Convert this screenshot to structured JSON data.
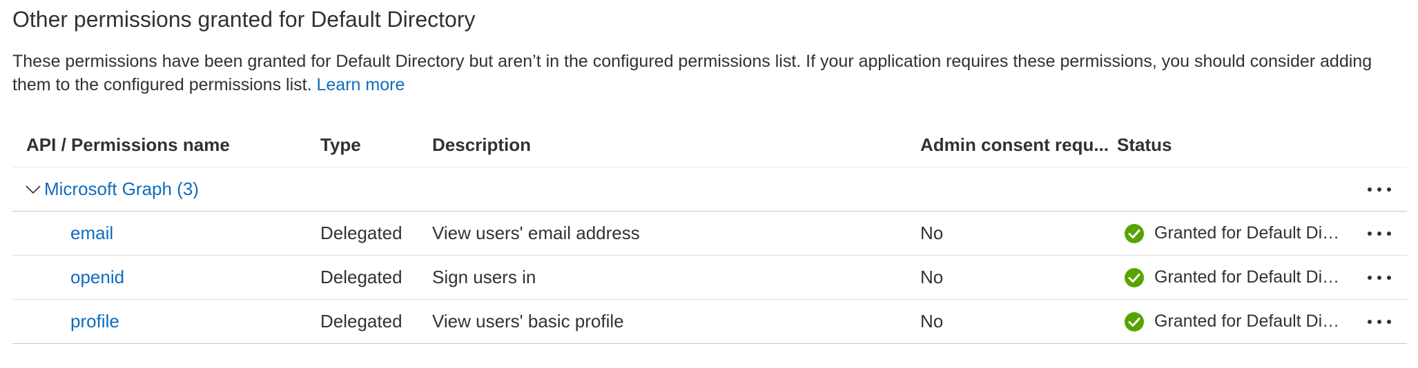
{
  "section": {
    "title": "Other permissions granted for Default Directory",
    "description": "These permissions have been granted for Default Directory but aren’t in the configured permissions list. If your application requires these permissions, you should consider adding them to the configured permissions list.",
    "learn_more_label": "Learn more"
  },
  "table": {
    "columns": {
      "name": "API / Permissions name",
      "type": "Type",
      "description": "Description",
      "admin": "Admin consent requ...",
      "status": "Status"
    },
    "group": {
      "label": "Microsoft Graph (3)",
      "expanded": true
    },
    "rows": [
      {
        "name": "email",
        "type": "Delegated",
        "description": "View users' email address",
        "admin": "No",
        "status": "Granted for Default Directory"
      },
      {
        "name": "openid",
        "type": "Delegated",
        "description": "Sign users in",
        "admin": "No",
        "status": "Granted for Default Directory"
      },
      {
        "name": "profile",
        "type": "Delegated",
        "description": "View users' basic profile",
        "admin": "No",
        "status": "Granted for Default Directory"
      }
    ]
  },
  "icons": {
    "status": "check-circle-icon",
    "more": "more-horizontal-icon",
    "expand": "chevron-down-icon"
  },
  "colors": {
    "link": "#0f6cbd",
    "success": "#57a300",
    "text": "#323130",
    "divider": "#e1dfdd"
  }
}
